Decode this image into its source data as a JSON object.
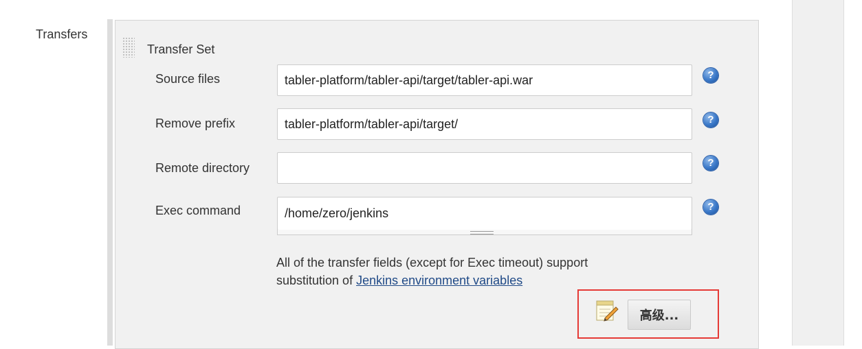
{
  "section": {
    "label": "Transfers"
  },
  "transfer_set": {
    "title": "Transfer Set",
    "fields": {
      "source_files": {
        "label": "Source files",
        "value": "tabler-platform/tabler-api/target/tabler-api.war"
      },
      "remove_prefix": {
        "label": "Remove prefix",
        "value": "tabler-platform/tabler-api/target/"
      },
      "remote_directory": {
        "label": "Remote directory",
        "value": ""
      },
      "exec_command": {
        "label": "Exec command",
        "value": "/home/zero/jenkins"
      }
    },
    "help_icon": "?",
    "help": {
      "line1": "All of the transfer fields (except for Exec timeout) support",
      "line2_prefix": "substitution of ",
      "link": "Jenkins environment variables"
    },
    "advanced_button": "高级..."
  },
  "icons": {
    "help": "question-circle-icon",
    "advanced": "notepad-icon",
    "drag": "drag-handle-icon"
  },
  "colors": {
    "highlight": "#e53935",
    "link": "#204a87",
    "help_icon": "#3a78c8"
  }
}
